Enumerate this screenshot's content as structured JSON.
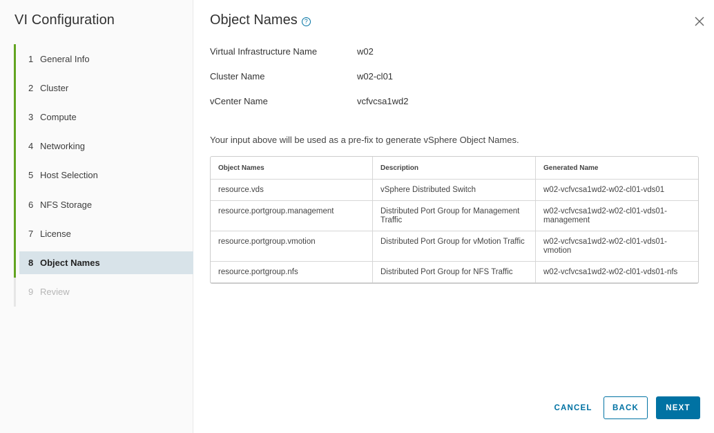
{
  "sidebar": {
    "title": "VI Configuration",
    "steps": [
      {
        "num": "1",
        "label": "General Info"
      },
      {
        "num": "2",
        "label": "Cluster"
      },
      {
        "num": "3",
        "label": "Compute"
      },
      {
        "num": "4",
        "label": "Networking"
      },
      {
        "num": "5",
        "label": "Host Selection"
      },
      {
        "num": "6",
        "label": "NFS Storage"
      },
      {
        "num": "7",
        "label": "License"
      },
      {
        "num": "8",
        "label": "Object Names"
      },
      {
        "num": "9",
        "label": "Review"
      }
    ],
    "active_step": "8",
    "accent_color": "#62a420"
  },
  "main": {
    "title": "Object Names",
    "help_icon": "help-circle-icon",
    "close_icon": "close-icon",
    "fields": [
      {
        "label": "Virtual Infrastructure Name",
        "value": "w02"
      },
      {
        "label": "Cluster Name",
        "value": "w02-cl01"
      },
      {
        "label": "vCenter Name",
        "value": "vcfvcsa1wd2"
      }
    ],
    "hint": "Your input above will be used as a pre-fix to generate vSphere Object Names.",
    "table": {
      "headers": [
        "Object Names",
        "Description",
        "Generated Name"
      ],
      "rows": [
        [
          "resource.vds",
          "vSphere Distributed Switch",
          "w02-vcfvcsa1wd2-w02-cl01-vds01"
        ],
        [
          "resource.portgroup.management",
          "Distributed Port Group for Management Traffic",
          "w02-vcfvcsa1wd2-w02-cl01-vds01-management"
        ],
        [
          "resource.portgroup.vmotion",
          "Distributed Port Group for vMotion Traffic",
          "w02-vcfvcsa1wd2-w02-cl01-vds01-vmotion"
        ],
        [
          "resource.portgroup.nfs",
          "Distributed Port Group for NFS Traffic",
          "w02-vcfvcsa1wd2-w02-cl01-vds01-nfs"
        ]
      ]
    }
  },
  "footer": {
    "cancel_label": "CANCEL",
    "back_label": "BACK",
    "next_label": "NEXT",
    "primary_color": "#0072a3"
  }
}
